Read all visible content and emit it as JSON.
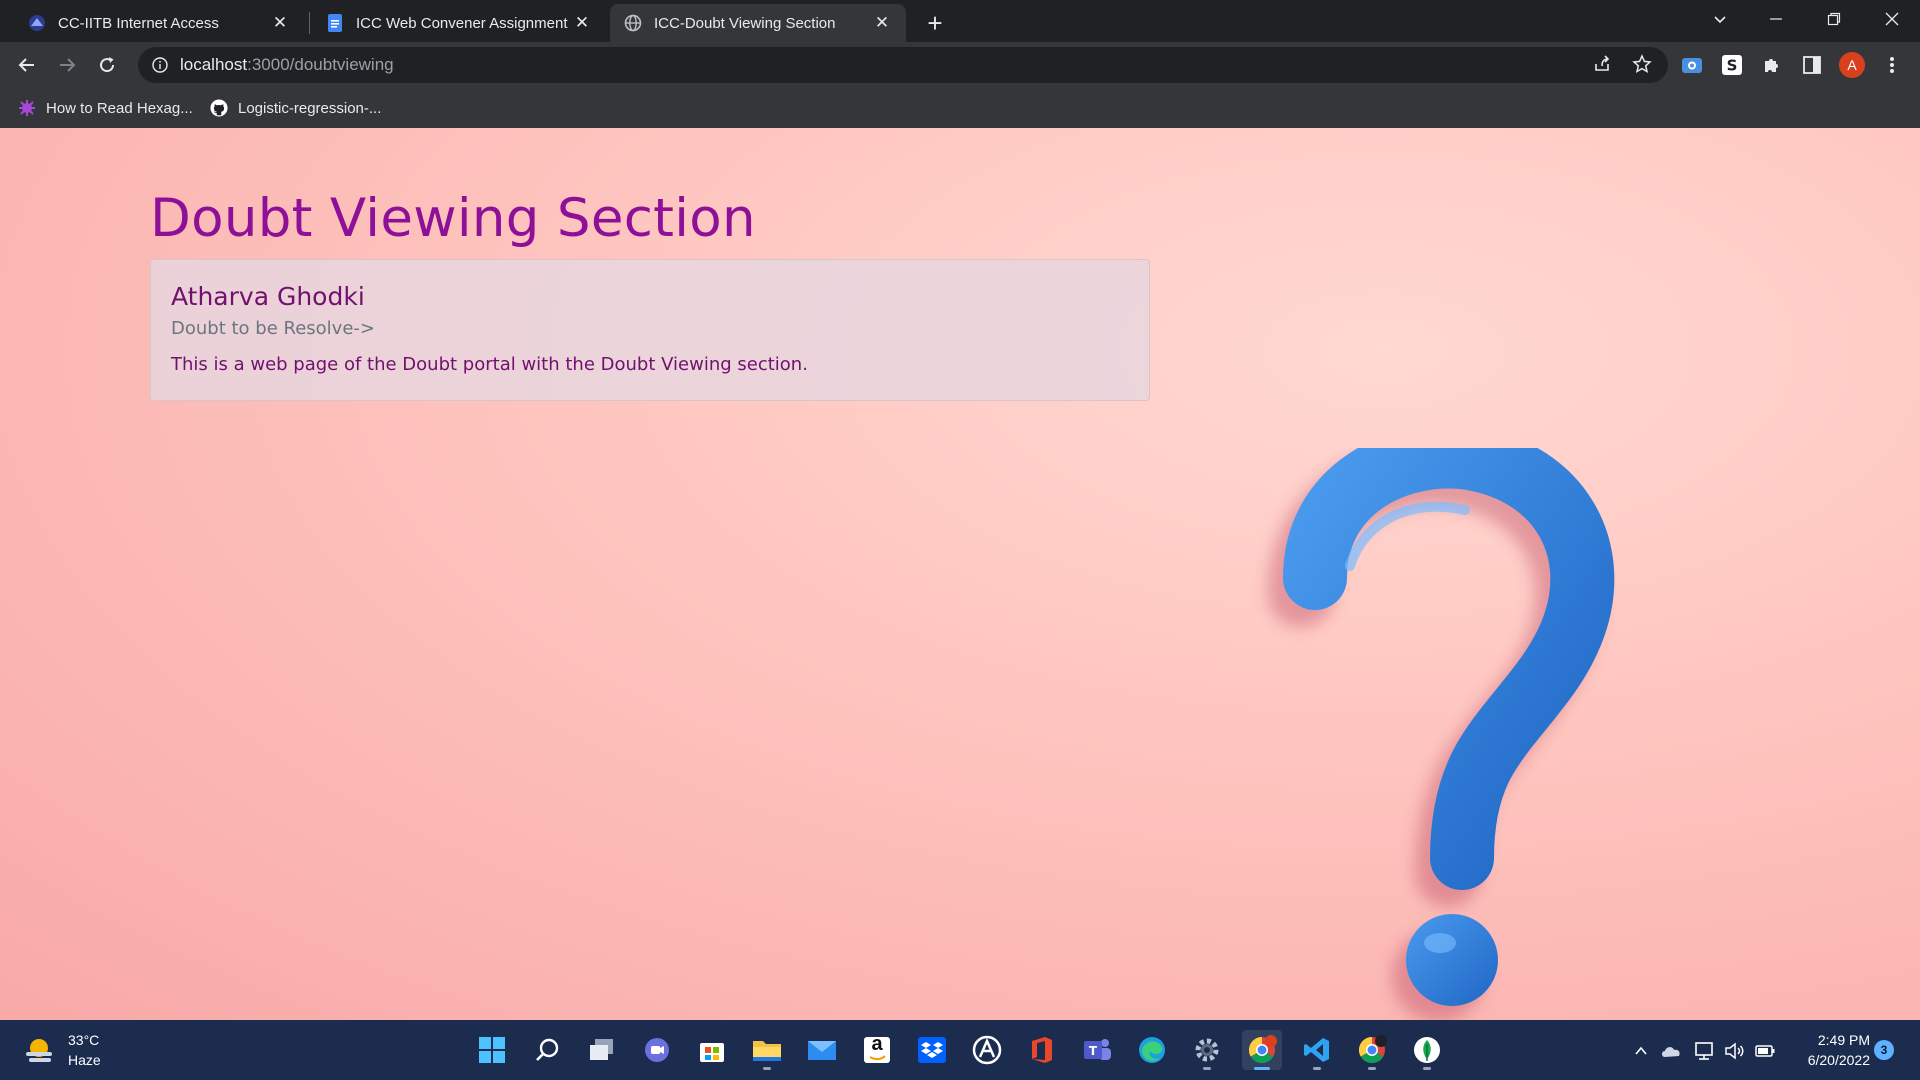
{
  "browser": {
    "tabs": [
      {
        "title": "CC-IITB Internet Access",
        "active": false
      },
      {
        "title": "ICC Web Convener Assignment -",
        "active": false
      },
      {
        "title": "ICC-Doubt Viewing Section",
        "active": true
      }
    ],
    "close_glyph": "✕",
    "new_tab_glyph": "+",
    "url_host": "localhost",
    "url_path": ":3000/doubtviewing",
    "profile_initial": "A",
    "bookmarks": [
      {
        "label": "How to Read Hexag..."
      },
      {
        "label": "Logistic-regression-..."
      }
    ]
  },
  "page": {
    "title": "Doubt Viewing Section",
    "card": {
      "name": "Atharva Ghodki",
      "subtitle": "Doubt to be Resolve->",
      "text": "This is a web page of the Doubt portal with the Doubt Viewing section."
    }
  },
  "taskbar": {
    "weather_temp": "33°C",
    "weather_desc": "Haze",
    "amazon_glyph": "a",
    "time": "2:49 PM",
    "date": "6/20/2022",
    "notification_count": "3"
  },
  "colors": {
    "page_title": "#8e0f98",
    "card_name": "#71106f",
    "taskbar": "#1c2c4f",
    "question_mark": "#2f7fd6"
  }
}
